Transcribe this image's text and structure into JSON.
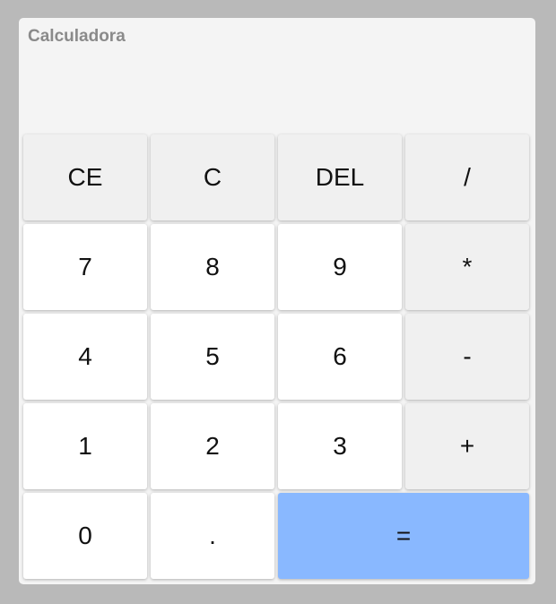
{
  "app": {
    "title": "Calculadora",
    "display_value": ""
  },
  "keypad": {
    "rows": [
      [
        {
          "id": "ce",
          "label": "CE",
          "kind": "function"
        },
        {
          "id": "c",
          "label": "C",
          "kind": "function"
        },
        {
          "id": "del",
          "label": "DEL",
          "kind": "function"
        },
        {
          "id": "divide",
          "label": "/",
          "kind": "operator"
        }
      ],
      [
        {
          "id": "7",
          "label": "7",
          "kind": "digit"
        },
        {
          "id": "8",
          "label": "8",
          "kind": "digit"
        },
        {
          "id": "9",
          "label": "9",
          "kind": "digit"
        },
        {
          "id": "multiply",
          "label": "*",
          "kind": "operator"
        }
      ],
      [
        {
          "id": "4",
          "label": "4",
          "kind": "digit"
        },
        {
          "id": "5",
          "label": "5",
          "kind": "digit"
        },
        {
          "id": "6",
          "label": "6",
          "kind": "digit"
        },
        {
          "id": "subtract",
          "label": "-",
          "kind": "operator"
        }
      ],
      [
        {
          "id": "1",
          "label": "1",
          "kind": "digit"
        },
        {
          "id": "2",
          "label": "2",
          "kind": "digit"
        },
        {
          "id": "3",
          "label": "3",
          "kind": "digit"
        },
        {
          "id": "add",
          "label": "+",
          "kind": "operator"
        }
      ],
      [
        {
          "id": "0",
          "label": "0",
          "kind": "digit"
        },
        {
          "id": "decimal",
          "label": ".",
          "kind": "digit"
        },
        {
          "id": "equals",
          "label": "=",
          "kind": "equals"
        }
      ]
    ]
  },
  "colors": {
    "background": "#b9b9b9",
    "panel": "#f4f4f4",
    "digit_key": "#ffffff",
    "function_key": "#f0f0f0",
    "equals_key": "#89b8ff",
    "title_text": "#8a8a8a"
  }
}
